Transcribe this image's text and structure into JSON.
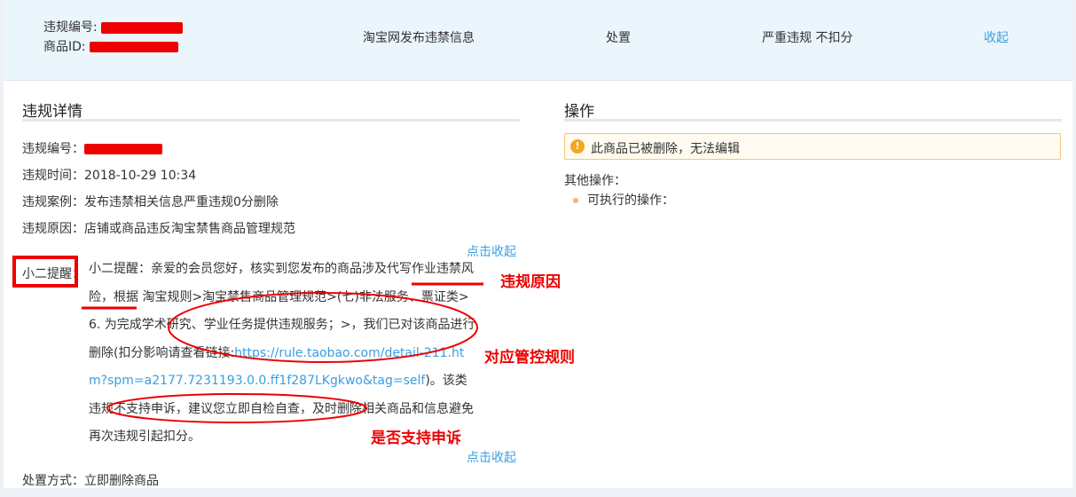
{
  "header": {
    "id_label": "违规编号:",
    "product_label": "商品ID:",
    "description": "淘宝网发布违禁信息",
    "action": "处置",
    "severity": "严重违规 不扣分",
    "collapse": "收起"
  },
  "details": {
    "title": "违规详情",
    "number_label": "违规编号：",
    "time_label": "违规时间：",
    "time_value": "2018-10-29 10:34",
    "case_label": "违规案例：",
    "case_value": "发布违禁相关信息严重违规0分删除",
    "reason_label": "违规原因：",
    "reason_value": "店铺或商品违反淘宝禁售商品管理规范",
    "fold_top": "点击收起",
    "remind_label": "小二提醒：",
    "remind_text_1": "小二提醒：亲爱的会员您好，核实到您发布的商品涉及代写作业违禁风险，根据 淘宝规则>淘宝禁售商品管理规范>(七)非法服务、票证类>6. 为完成学术研究、学业任务提供违规服务；>，我们已对该商品进行删除(扣分影响请查看链接:",
    "remind_link": "https://rule.taobao.com/detail-211.htm?spm=a2177.7231193.0.0.ff1f287LKgkwo&tag=self",
    "remind_text_2": ")。该类违规不支持申诉，建议您立即自检自查，及时删除相关商品和信息避免再次违规引起扣分。",
    "fold_bottom": "点击收起",
    "handle_label": "处置方式：",
    "handle_value": "立即删除商品"
  },
  "operations": {
    "title": "操作",
    "warning": "此商品已被删除，无法编辑",
    "other_label": "其他操作：",
    "executable_label": "可执行的操作："
  },
  "annotations": {
    "reason": "违规原因",
    "rule": "对应管控规则",
    "appeal": "是否支持申诉"
  },
  "colors": {
    "accent_link": "#3a9ee0",
    "annotation_red": "#ee0000",
    "header_bg": "#eaf5fc",
    "warning_border": "#f0c77e"
  }
}
